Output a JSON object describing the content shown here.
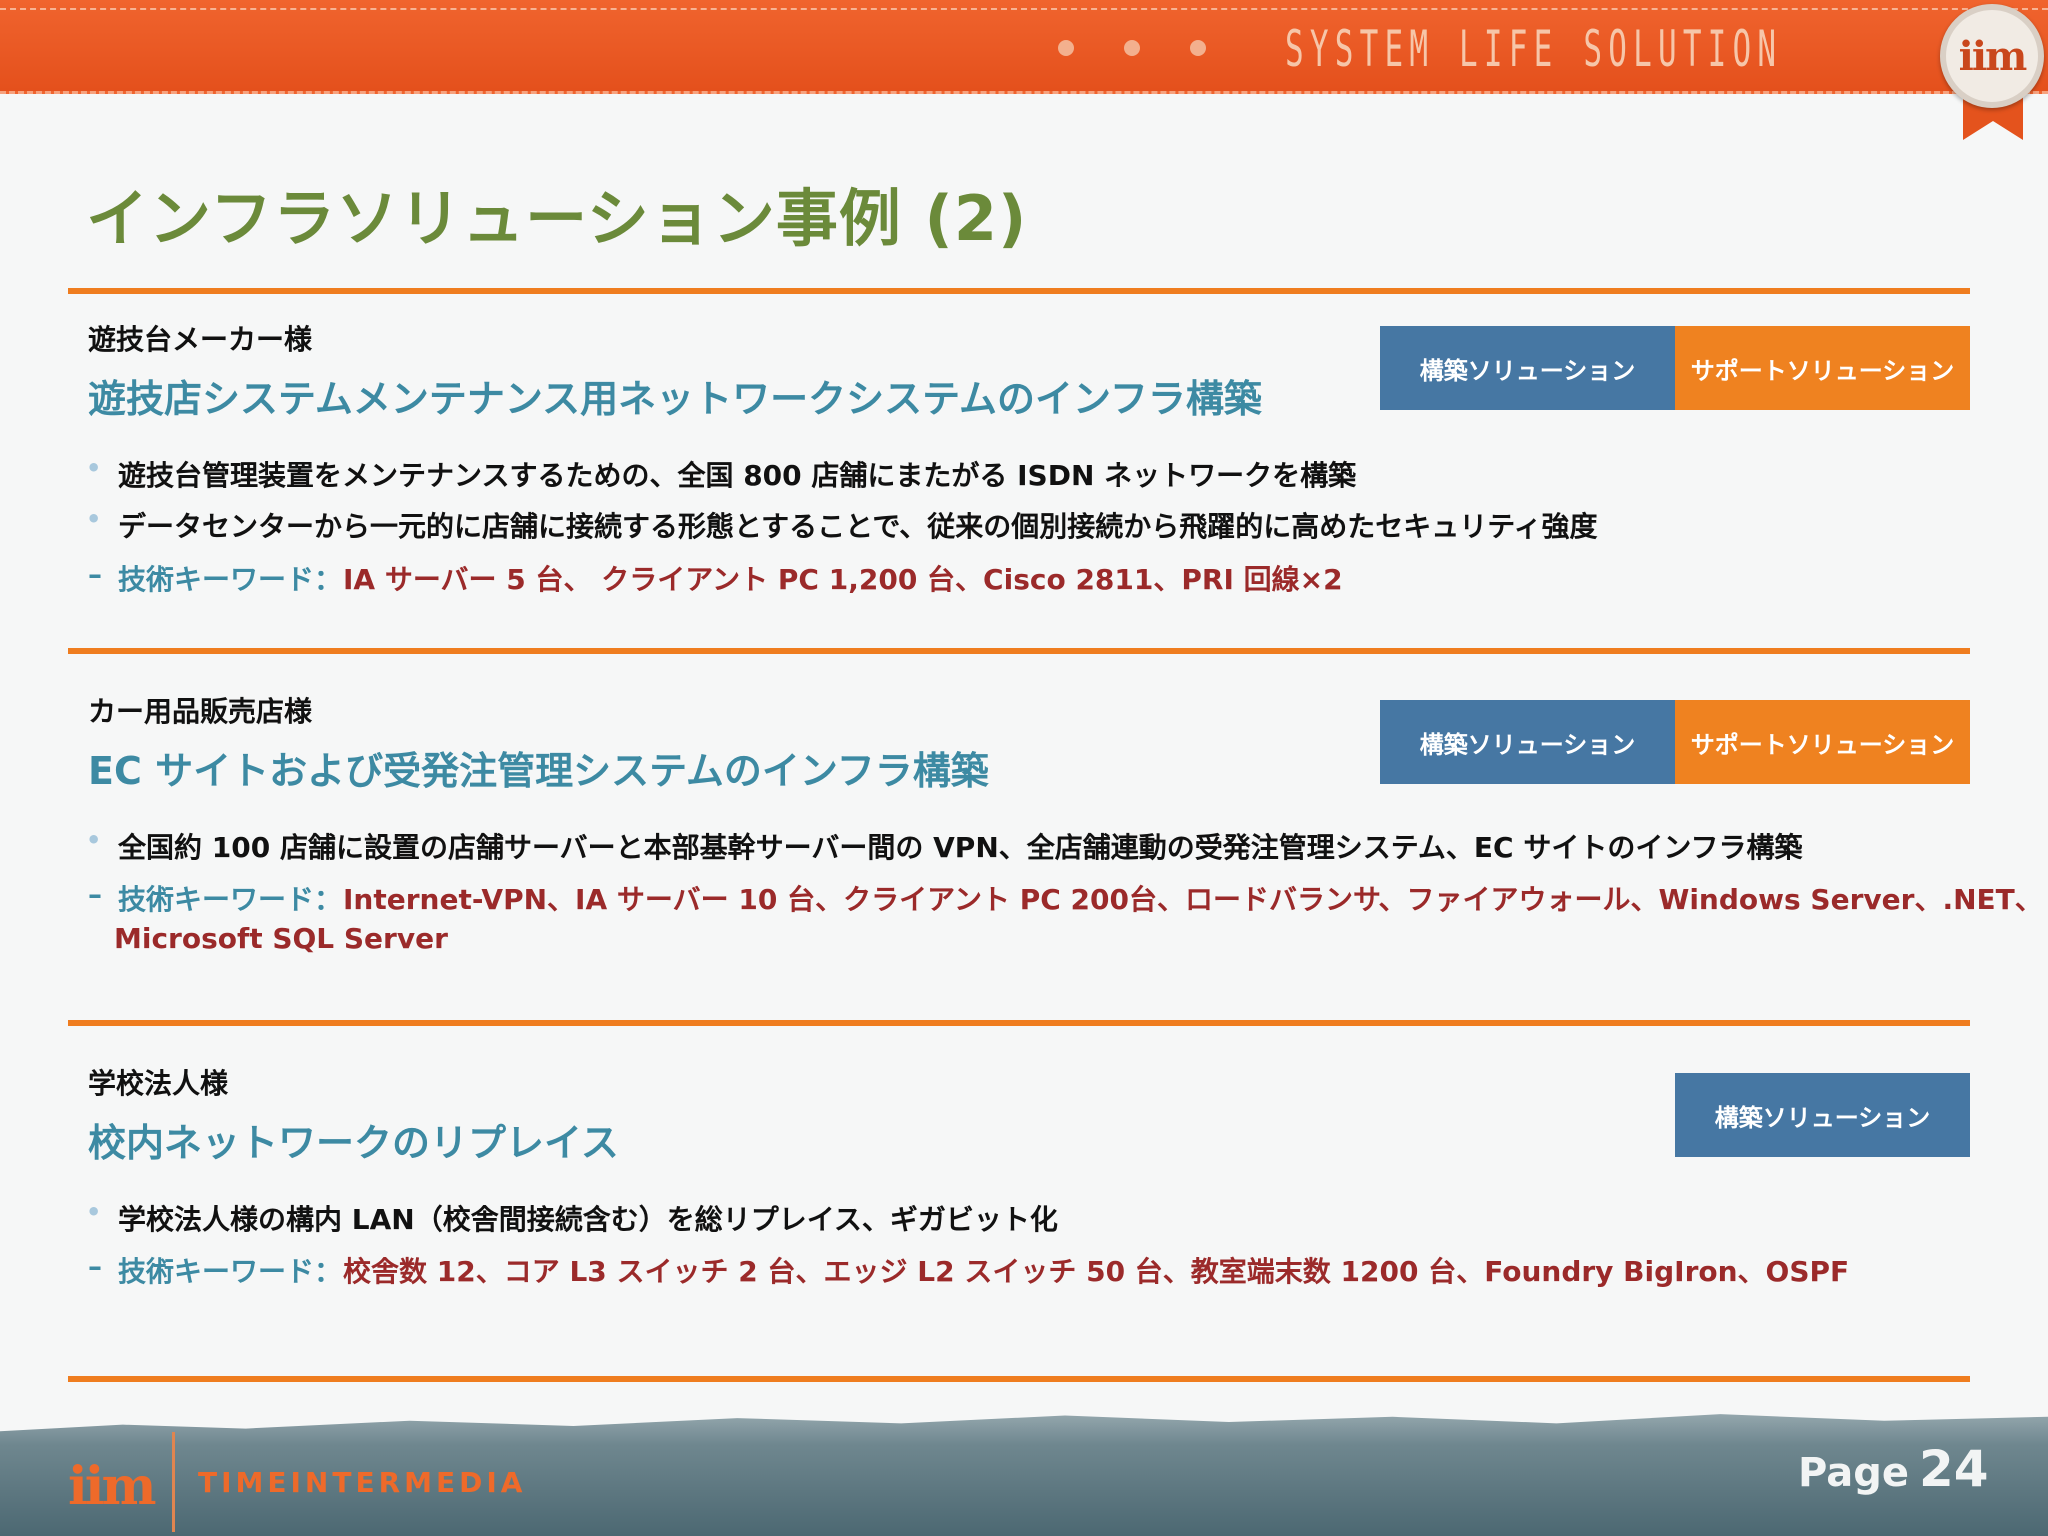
{
  "header": {
    "tagline": "SYSTEM LIFE SOLUTION",
    "seal_logo": "iim"
  },
  "title": "インフラソリューション事例 (2)",
  "sections": [
    {
      "client": "遊技台メーカー様",
      "subtitle": "遊技店システムメンテナンス用ネットワークシステムのインフラ構築",
      "badges": [
        "構築ソリューション",
        "サポートソリューション"
      ],
      "bullets": [
        "遊技台管理装置をメンテナンスするための、全国 800 店舗にまたがる ISDN ネットワークを構築",
        "データセンターから一元的に店舗に接続する形態とすることで、従来の個別接続から飛躍的に高めたセキュリティ強度"
      ],
      "keyword_label": "技術キーワード：",
      "keyword_value": "IA サーバー 5 台、 クライアント PC 1,200 台、Cisco 2811、PRI 回線×2"
    },
    {
      "client": "カー用品販売店様",
      "subtitle": "EC サイトおよび受発注管理システムのインフラ構築",
      "badges": [
        "構築ソリューション",
        "サポートソリューション"
      ],
      "bullets": [
        "全国約 100 店舗に設置の店舗サーバーと本部基幹サーバー間の VPN、全店舗連動の受発注管理システム、EC サイトのインフラ構築"
      ],
      "keyword_label": "技術キーワード：",
      "keyword_value": "Internet-VPN、IA サーバー 10 台、クライアント PC 200台、ロードバランサ、ファイアウォール、Windows Server、.NET、",
      "keyword_value_cont": "Microsoft SQL Server"
    },
    {
      "client": "学校法人様",
      "subtitle": "校内ネットワークのリプレイス",
      "badges": [
        "構築ソリューション"
      ],
      "bullets": [
        "学校法人様の構内 LAN（校舎間接続含む）を総リプレイス、ギガビット化"
      ],
      "keyword_label": "技術キーワード：",
      "keyword_value": "校舎数 12、コア L3 スイッチ 2 台、エッジ L2 スイッチ 50 台、教室端末数 1200 台、Foundry BigIron、OSPF"
    }
  ],
  "footer": {
    "logo": "iim",
    "brand": "TIMEINTERMEDIA",
    "page_label": "Page",
    "page_number": "24"
  },
  "colors": {
    "header_orange": "#e4501c",
    "title_green": "#6b8a3a",
    "subtitle_teal": "#3d8aa3",
    "keyword_red": "#9b2a2a",
    "rule_orange": "#ef7d1f",
    "badge_blue": "#4677a3",
    "badge_orange": "#ef8220"
  }
}
